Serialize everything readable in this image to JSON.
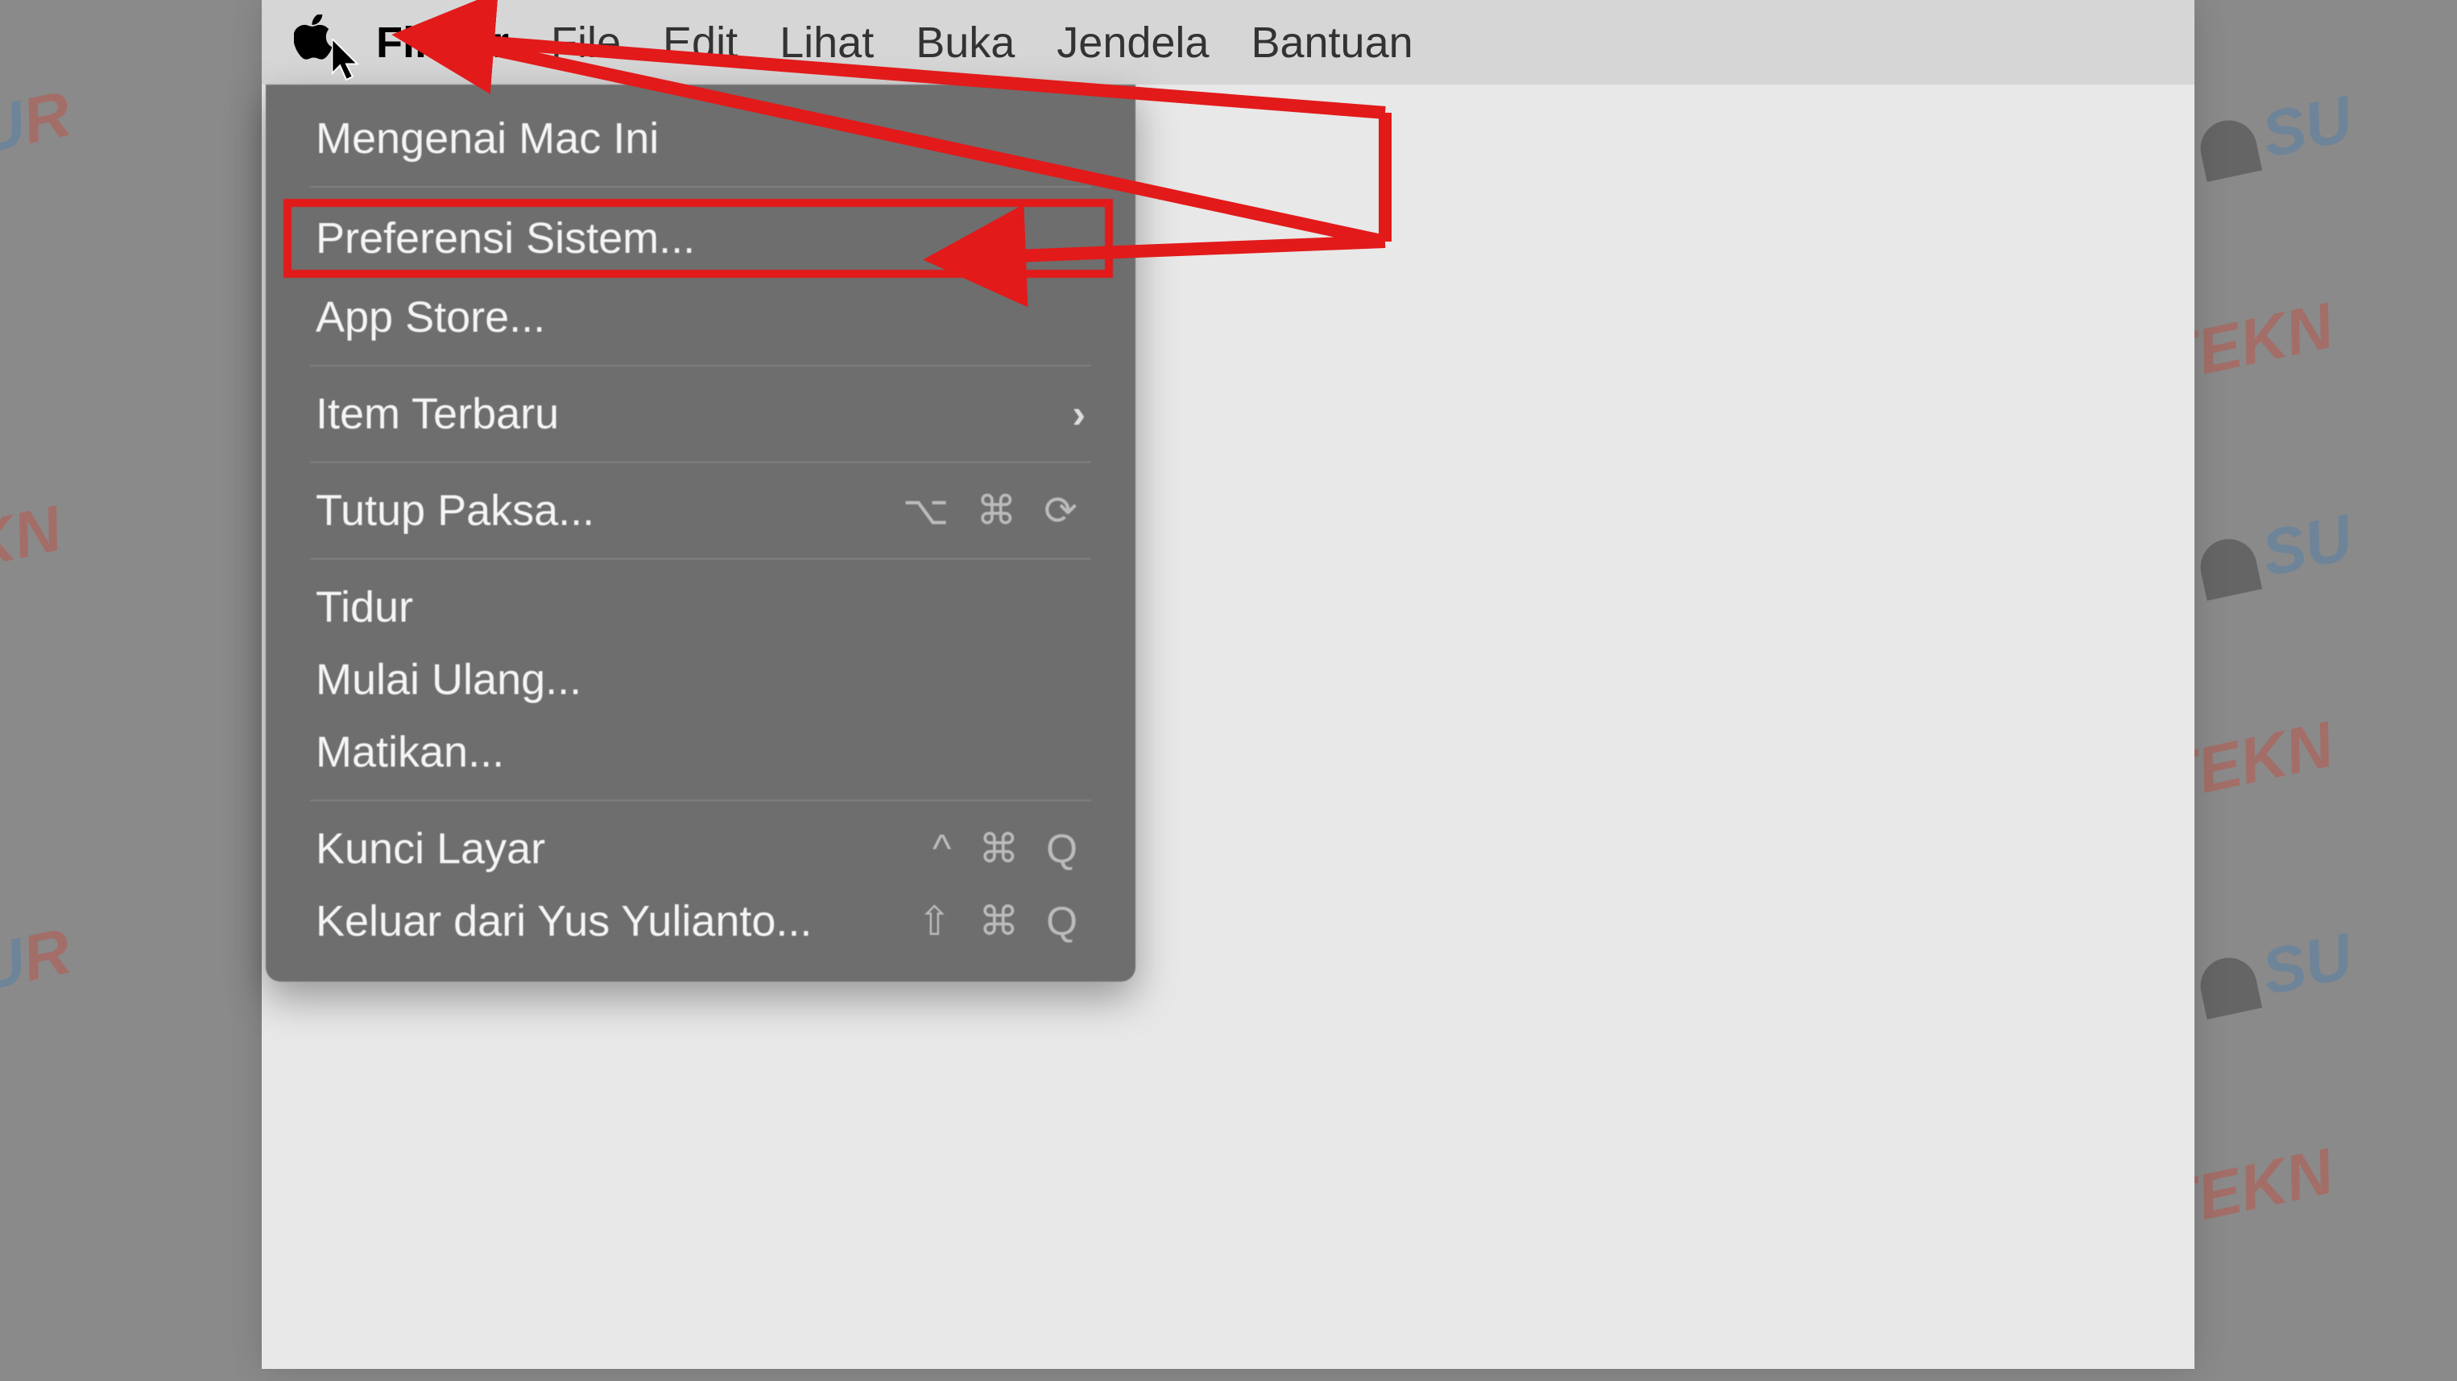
{
  "menubar": {
    "app_name": "Finder",
    "items": [
      "File",
      "Edit",
      "Lihat",
      "Buka",
      "Jendela",
      "Bantuan"
    ]
  },
  "apple_menu": {
    "about": "Mengenai Mac Ini",
    "sys_prefs": "Preferensi Sistem...",
    "app_store": "App Store...",
    "recent_items": "Item Terbaru",
    "force_quit": "Tutup Paksa...",
    "force_quit_shortcut": "⌥ ⌘ ⟳",
    "sleep": "Tidur",
    "restart": "Mulai Ulang...",
    "shutdown": "Matikan...",
    "lock_screen": "Kunci Layar",
    "lock_shortcut": "^ ⌘ Q",
    "logout": "Keluar dari Yus Yulianto...",
    "logout_shortcut": "⇧ ⌘ Q"
  },
  "watermark_text": {
    "a": "SU",
    "b": "TEKN"
  }
}
